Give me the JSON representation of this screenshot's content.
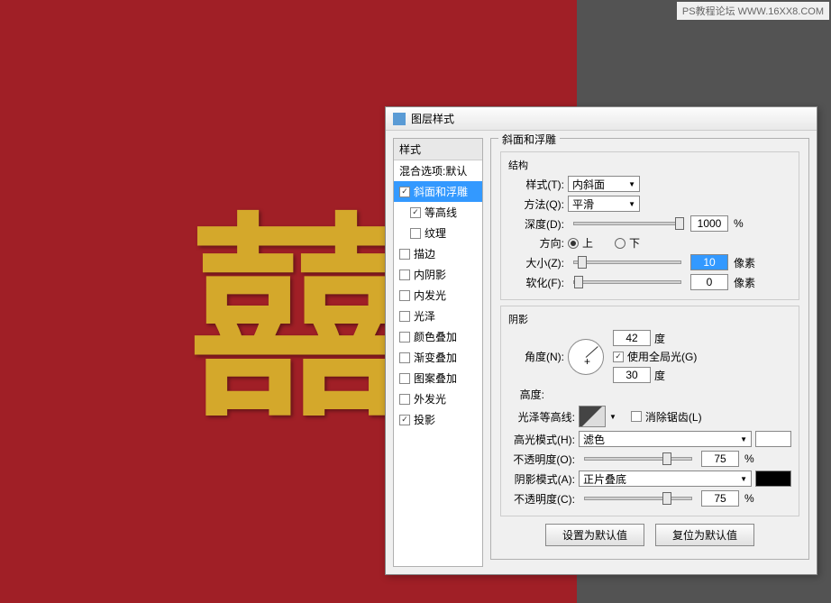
{
  "watermark": "PS教程论坛 WWW.16XX8.COM",
  "canvas_text": "囍",
  "dialog": {
    "title": "图层样式",
    "sidebar": {
      "header": "样式",
      "blend_options": "混合选项:默认",
      "items": [
        {
          "label": "斜面和浮雕",
          "checked": true,
          "selected": true
        },
        {
          "label": "等高线",
          "checked": true,
          "indent": true
        },
        {
          "label": "纹理",
          "checked": false,
          "indent": true
        },
        {
          "label": "描边",
          "checked": false
        },
        {
          "label": "内阴影",
          "checked": false
        },
        {
          "label": "内发光",
          "checked": false
        },
        {
          "label": "光泽",
          "checked": false
        },
        {
          "label": "颜色叠加",
          "checked": false
        },
        {
          "label": "渐变叠加",
          "checked": false
        },
        {
          "label": "图案叠加",
          "checked": false
        },
        {
          "label": "外发光",
          "checked": false
        },
        {
          "label": "投影",
          "checked": true
        }
      ]
    },
    "panel": {
      "legend": "斜面和浮雕",
      "structure": {
        "legend": "结构",
        "style_label": "样式(T):",
        "style_value": "内斜面",
        "method_label": "方法(Q):",
        "method_value": "平滑",
        "depth_label": "深度(D):",
        "depth_value": "1000",
        "depth_unit": "%",
        "direction_label": "方向:",
        "up_label": "上",
        "down_label": "下",
        "size_label": "大小(Z):",
        "size_value": "10",
        "size_unit": "像素",
        "soften_label": "软化(F):",
        "soften_value": "0",
        "soften_unit": "像素"
      },
      "shading": {
        "legend": "阴影",
        "angle_label": "角度(N):",
        "angle_value": "42",
        "angle_unit": "度",
        "global_light_label": "使用全局光(G)",
        "altitude_label": "高度:",
        "altitude_value": "30",
        "altitude_unit": "度",
        "gloss_label": "光泽等高线:",
        "antialias_label": "消除锯齿(L)",
        "highlight_mode_label": "高光模式(H):",
        "highlight_mode_value": "滤色",
        "highlight_color": "#ffffff",
        "highlight_opacity_label": "不透明度(O):",
        "highlight_opacity_value": "75",
        "highlight_opacity_unit": "%",
        "shadow_mode_label": "阴影模式(A):",
        "shadow_mode_value": "正片叠底",
        "shadow_color": "#000000",
        "shadow_opacity_label": "不透明度(C):",
        "shadow_opacity_value": "75",
        "shadow_opacity_unit": "%"
      }
    },
    "buttons": {
      "default": "设置为默认值",
      "reset": "复位为默认值"
    }
  }
}
